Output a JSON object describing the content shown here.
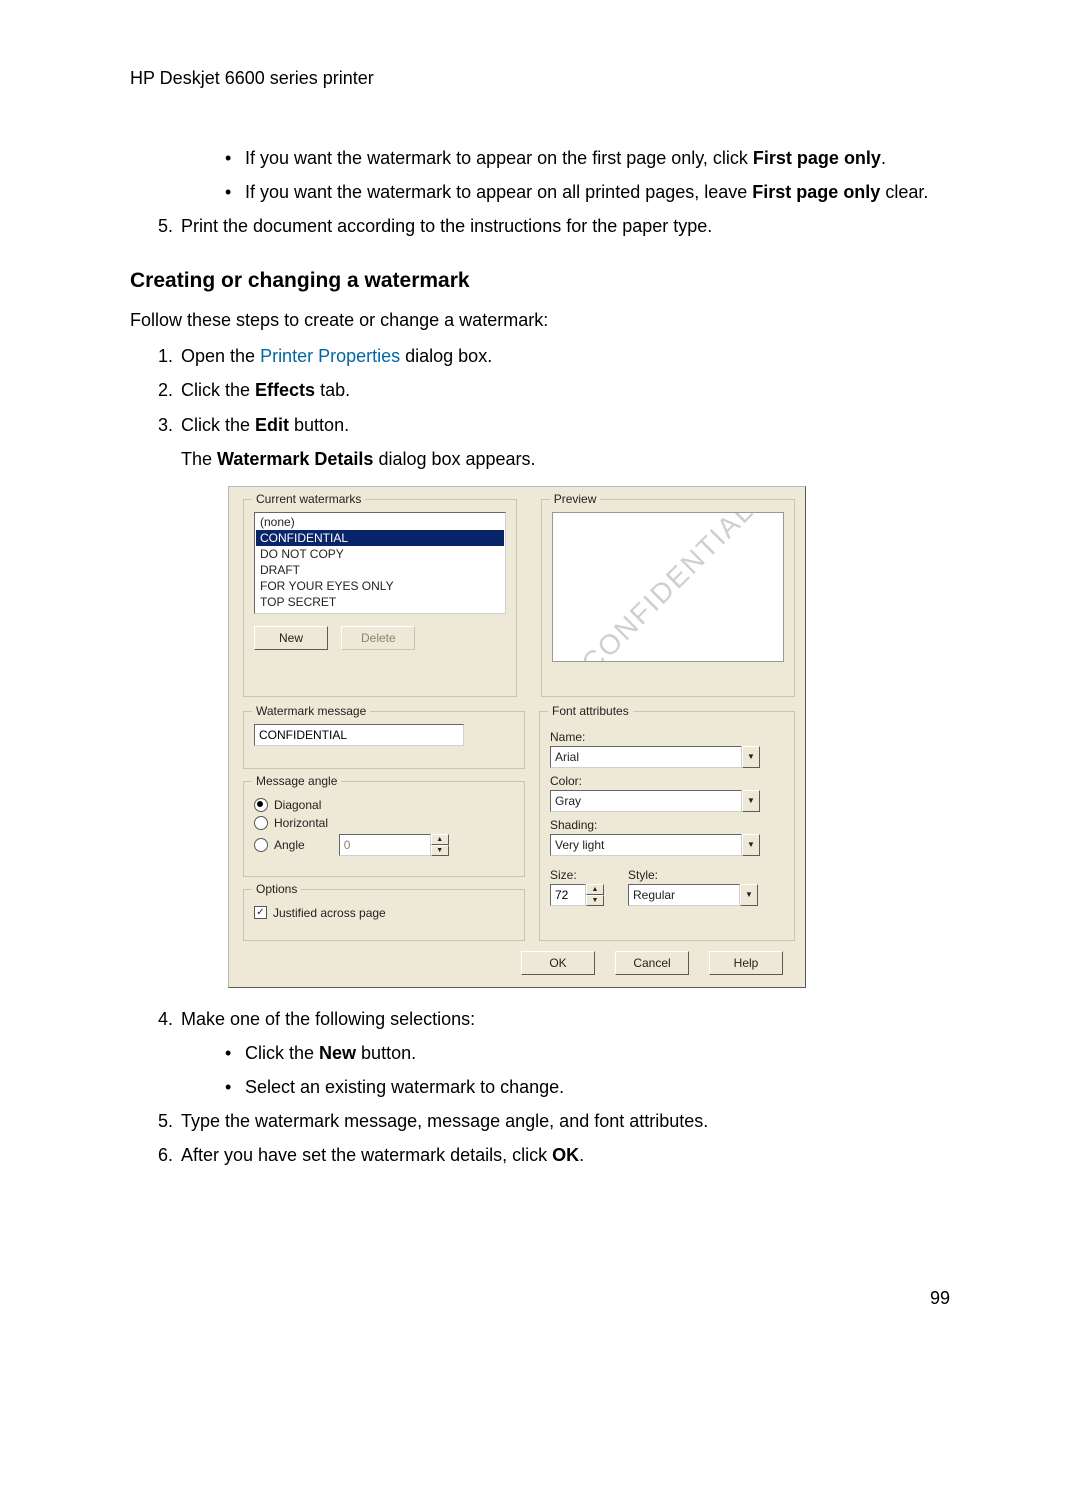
{
  "header": "HP Deskjet 6600 series printer",
  "intro_bullets": [
    {
      "pre": "If you want the watermark to appear on the first page only, click ",
      "bold": "First page only",
      "post": "."
    },
    {
      "pre": "If you want the watermark to appear on all printed pages, leave ",
      "bold": "First page only",
      "post": " clear."
    }
  ],
  "intro_step5": {
    "num": "5.",
    "text": "Print the document according to the instructions for the paper type."
  },
  "section_title": "Creating or changing a watermark",
  "section_intro": "Follow these steps to create or change a watermark:",
  "steps_a": [
    {
      "num": "1.",
      "pre": "Open the ",
      "link": "Printer Properties",
      "post": " dialog box."
    },
    {
      "num": "2.",
      "pre": "Click the ",
      "bold": "Effects",
      "post": " tab."
    },
    {
      "num": "3.",
      "pre": "Click the ",
      "bold": "Edit",
      "post": " button."
    }
  ],
  "under3": {
    "pre": "The ",
    "bold": "Watermark Details",
    "post": " dialog box appears."
  },
  "dialog": {
    "groups": {
      "current": "Current watermarks",
      "preview": "Preview",
      "message": "Watermark message",
      "angle": "Message angle",
      "options": "Options",
      "font": "Font attributes"
    },
    "list": {
      "items": [
        "(none)",
        "CONFIDENTIAL",
        "DO NOT COPY",
        "DRAFT",
        "FOR YOUR EYES ONLY",
        "TOP SECRET"
      ],
      "selected_index": 1
    },
    "buttons": {
      "new": "New",
      "delete": "Delete",
      "ok": "OK",
      "cancel": "Cancel",
      "help": "Help"
    },
    "preview_text": "CONFIDENTIAL",
    "message_value": "CONFIDENTIAL",
    "angles": {
      "diagonal": "Diagonal",
      "horizontal": "Horizontal",
      "angle": "Angle",
      "angle_value": "0"
    },
    "option_justified": "Justified across page",
    "font": {
      "name_label": "Name:",
      "name_value": "Arial",
      "color_label": "Color:",
      "color_value": "Gray",
      "shading_label": "Shading:",
      "shading_value": "Very light",
      "size_label": "Size:",
      "size_value": "72",
      "style_label": "Style:",
      "style_value": "Regular"
    }
  },
  "steps_b": {
    "step4": {
      "num": "4.",
      "text": "Make one of the following selections:"
    },
    "step4_bullets": [
      {
        "pre": "Click the ",
        "bold": "New",
        "post": " button."
      },
      {
        "plain": "Select an existing watermark to change."
      }
    ],
    "step5": {
      "num": "5.",
      "text": "Type the watermark message, message angle, and font attributes."
    },
    "step6": {
      "num": "6.",
      "pre": "After you have set the watermark details, click ",
      "bold": "OK",
      "post": "."
    }
  },
  "pagenum": "99"
}
